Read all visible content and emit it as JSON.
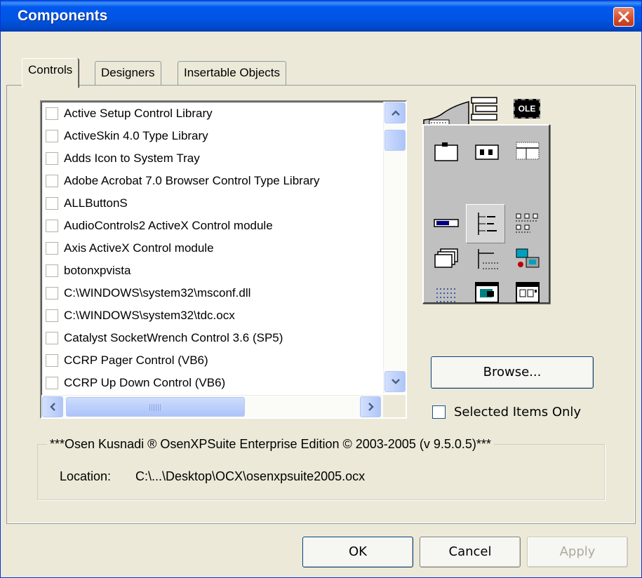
{
  "window": {
    "title": "Components",
    "close_icon": "close-x-icon",
    "colors": {
      "titlebar": "#0054e3",
      "close": "#d6512f",
      "face": "#ece9d8"
    }
  },
  "tabs": [
    {
      "label": "Controls",
      "active": true
    },
    {
      "label": "Designers",
      "active": false
    },
    {
      "label": "Insertable Objects",
      "active": false
    }
  ],
  "components": [
    "Active Setup Control Library",
    "ActiveSkin 4.0 Type Library",
    "Adds Icon to System Tray",
    "Adobe Acrobat 7.0 Browser Control Type Library",
    "ALLButtonS",
    "AudioControls2 ActiveX Control module",
    "Axis ActiveX Control module",
    "botonxpvista",
    "C:\\WINDOWS\\system32\\msconf.dll",
    "C:\\WINDOWS\\system32\\tdc.ocx",
    "Catalyst SocketWrench Control 3.6 (SP5)",
    "CCRP Pager Control (VB6)",
    "CCRP Up Down Control (VB6)"
  ],
  "palette": {
    "icons": [
      "ribbon-icon",
      "treeview-header-icon",
      "ole-icon",
      "frame-icon",
      "pager-icon",
      "header-icon",
      "progressbar-icon",
      "treeview-icon",
      "listview-icon",
      "tabstrip-icon",
      "hierarchy-icon",
      "network-icon",
      "grid-dots-icon",
      "image-window-icon",
      "calendar-window-icon"
    ],
    "badge_text": "OLE"
  },
  "browse_label": "Browse...",
  "selected_only_label": "Selected Items Only",
  "group": {
    "title": "***Osen Kusnadi ® OsenXPSuite Enterprise Edition © 2003-2005 (v 9.5.0.5)***",
    "location_label": "Location:",
    "location_value": "C:\\...\\Desktop\\OCX\\osenxpsuite2005.ocx"
  },
  "buttons": {
    "ok": "OK",
    "cancel": "Cancel",
    "apply": "Apply"
  }
}
